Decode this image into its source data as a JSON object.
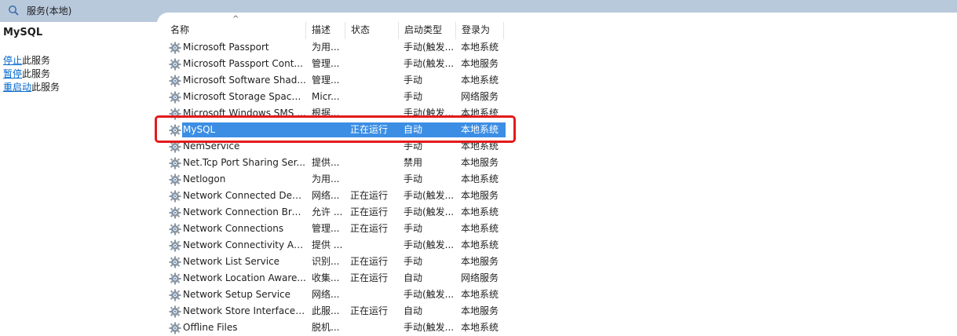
{
  "topbar": {
    "title": "服务(本地)",
    "icon": "search-icon"
  },
  "left_panel": {
    "service_name": "MySQL",
    "actions": [
      {
        "link": "停止",
        "suffix": "此服务"
      },
      {
        "link": "暂停",
        "suffix": "此服务"
      },
      {
        "link": "重启动",
        "suffix": "此服务"
      }
    ]
  },
  "columns": [
    "名称",
    "描述",
    "状态",
    "启动类型",
    "登录为"
  ],
  "sort_indicator": "^",
  "rows": [
    {
      "name": "Microsoft Passport",
      "desc": "为用...",
      "status": "",
      "start": "手动(触发...",
      "logon": "本地系统"
    },
    {
      "name": "Microsoft Passport Cont...",
      "desc": "管理...",
      "status": "",
      "start": "手动(触发...",
      "logon": "本地服务"
    },
    {
      "name": "Microsoft Software Shad...",
      "desc": "管理...",
      "status": "",
      "start": "手动",
      "logon": "本地系统"
    },
    {
      "name": "Microsoft Storage Space...",
      "desc": "Micr...",
      "status": "",
      "start": "手动",
      "logon": "网络服务"
    },
    {
      "name": "Microsoft Windows SMS ...",
      "desc": "根据...",
      "status": "",
      "start": "手动(触发...",
      "logon": "本地系统"
    },
    {
      "name": "MySQL",
      "desc": "",
      "status": "正在运行",
      "start": "自动",
      "logon": "本地系统",
      "selected": true
    },
    {
      "name": "NemService",
      "desc": "",
      "status": "",
      "start": "手动",
      "logon": "本地系统"
    },
    {
      "name": "Net.Tcp Port Sharing Ser...",
      "desc": "提供...",
      "status": "",
      "start": "禁用",
      "logon": "本地服务"
    },
    {
      "name": "Netlogon",
      "desc": "为用...",
      "status": "",
      "start": "手动",
      "logon": "本地系统"
    },
    {
      "name": "Network Connected Devi...",
      "desc": "网络...",
      "status": "正在运行",
      "start": "手动(触发...",
      "logon": "本地服务"
    },
    {
      "name": "Network Connection Bro...",
      "desc": "允许 ...",
      "status": "正在运行",
      "start": "手动(触发...",
      "logon": "本地系统"
    },
    {
      "name": "Network Connections",
      "desc": "管理...",
      "status": "正在运行",
      "start": "手动",
      "logon": "本地系统"
    },
    {
      "name": "Network Connectivity Ass...",
      "desc": "提供 ...",
      "status": "",
      "start": "手动(触发...",
      "logon": "本地系统"
    },
    {
      "name": "Network List Service",
      "desc": "识别...",
      "status": "正在运行",
      "start": "手动",
      "logon": "本地服务"
    },
    {
      "name": "Network Location Aware...",
      "desc": "收集...",
      "status": "正在运行",
      "start": "自动",
      "logon": "网络服务"
    },
    {
      "name": "Network Setup Service",
      "desc": "网络...",
      "status": "",
      "start": "手动(触发...",
      "logon": "本地系统"
    },
    {
      "name": "Network Store Interface ...",
      "desc": "此服...",
      "status": "正在运行",
      "start": "自动",
      "logon": "本地服务"
    },
    {
      "name": "Offline Files",
      "desc": "脱机...",
      "status": "",
      "start": "手动(触发...",
      "logon": "本地系统"
    }
  ]
}
